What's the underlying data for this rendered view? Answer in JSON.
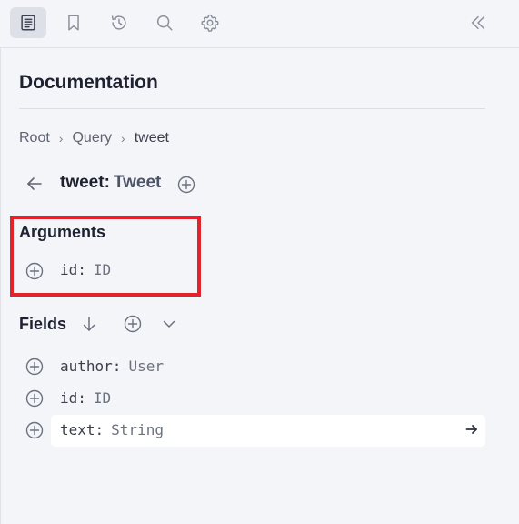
{
  "toolbar": {
    "items": [
      {
        "icon": "docs-icon",
        "active": true
      },
      {
        "icon": "bookmark-icon",
        "active": false
      },
      {
        "icon": "history-icon",
        "active": false
      },
      {
        "icon": "search-icon",
        "active": false
      },
      {
        "icon": "gear-icon",
        "active": false
      }
    ],
    "collapse_icon": "double-chevron-left-icon"
  },
  "panel": {
    "title": "Documentation",
    "breadcrumb": [
      "Root",
      "Query",
      "tweet"
    ],
    "breadcrumb_separator": "›",
    "type_header": {
      "name": "tweet",
      "colon": ":",
      "type": "Tweet"
    },
    "arguments": {
      "title": "Arguments",
      "items": [
        {
          "name": "id",
          "colon": ":",
          "type": "ID"
        }
      ]
    },
    "fields": {
      "title": "Fields",
      "items": [
        {
          "name": "author",
          "colon": ":",
          "type": "User"
        },
        {
          "name": "id",
          "colon": ":",
          "type": "ID"
        },
        {
          "name": "text",
          "colon": ":",
          "type": "String",
          "selected": true
        }
      ]
    }
  },
  "colors": {
    "highlight": "#e3232b",
    "background": "#f4f5f8",
    "selected_row": "#ffffff"
  }
}
